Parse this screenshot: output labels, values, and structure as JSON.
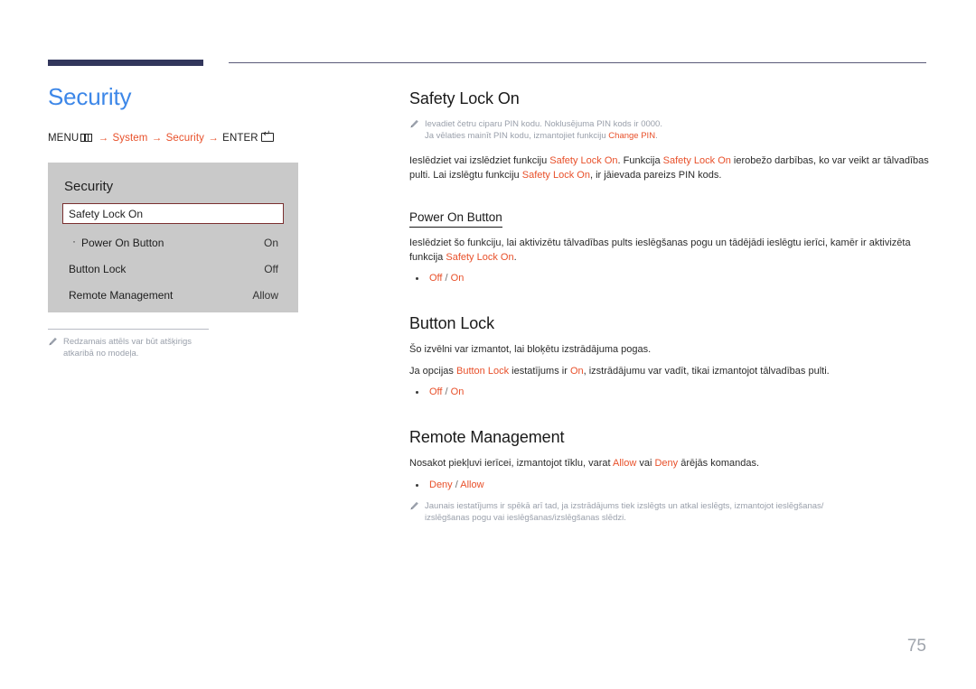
{
  "header": {
    "rule_color_thick": "#32365c",
    "rule_color_thin": "#5a5a78"
  },
  "left": {
    "page_title": "Security",
    "breadcrumb": {
      "menu_label": "MENU",
      "menu_icon": "menu-grid-icon",
      "arrow": "→",
      "item1": "System",
      "item2": "Security",
      "enter_label": "ENTER",
      "enter_icon": "enter-key-icon"
    },
    "osd": {
      "title": "Security",
      "rows": [
        {
          "label": "Safety Lock On",
          "value": "",
          "selected": true,
          "sub": false
        },
        {
          "label": "Power On Button",
          "value": "On",
          "selected": false,
          "sub": true
        },
        {
          "label": "Button Lock",
          "value": "Off",
          "selected": false,
          "sub": false
        },
        {
          "label": "Remote Management",
          "value": "Allow",
          "selected": false,
          "sub": false
        }
      ]
    },
    "note": "Redzamais attēls var būt atšķirigs atkaribā no modeļa."
  },
  "right": {
    "sections": [
      {
        "heading": "Safety Lock On",
        "note_line1": "Ievadiet četru ciparu PIN kodu. Noklusējuma PIN kods ir 0000.",
        "note_line2_a": "Ja vēlaties mainīt PIN kodu, izmantojiet funkciju ",
        "note_line2_b": "Change PIN",
        "note_line2_c": ".",
        "body_a": "Ieslēdziet vai izslēdziet funkciju ",
        "body_b": "Safety Lock On",
        "body_c": ". Funkcija ",
        "body_d": "Safety Lock On",
        "body_e": " ierobežo darbības, ko var veikt ar tālvadības pulti. Lai izslēgtu funkciju ",
        "body_f": "Safety Lock On",
        "body_g": ", ir jāievada pareizs PIN kods."
      }
    ],
    "power_on_button": {
      "heading": "Power On Button",
      "body_a": "Ieslēdziet šo funkciju, lai aktivizētu tālvadības pults ieslēgšanas pogu un tādējādi ieslēgtu ierīci, kamēr ir aktivizēta funkcija ",
      "body_b": "Safety Lock On",
      "body_c": ".",
      "option_off": "Off",
      "option_slash": " / ",
      "option_on": "On"
    },
    "button_lock": {
      "heading": "Button Lock",
      "body1": "Šo izvēlni var izmantot, lai bloķētu izstrādājuma pogas.",
      "body2_a": "Ja opcijas ",
      "body2_b": "Button Lock",
      "body2_c": " iestatījums ir ",
      "body2_d": "On",
      "body2_e": ", izstrādājumu var vadīt, tikai izmantojot tālvadības pulti.",
      "option_off": "Off",
      "option_slash": " / ",
      "option_on": "On"
    },
    "remote_management": {
      "heading": "Remote Management",
      "body_a": "Nosakot piekļuvi ierīcei, izmantojot tīklu, varat ",
      "body_b": "Allow",
      "body_c": " vai ",
      "body_d": "Deny",
      "body_e": " ārējās komandas.",
      "option_deny": "Deny",
      "option_slash": " / ",
      "option_allow": "Allow",
      "note_line1": "Jaunais iestatījums ir spēkā arī tad, ja izstrādājums tiek izslēgts un atkal ieslēgts, izmantojot ieslēgšanas/",
      "note_line2": "izslēgšanas pogu vai ieslēgšanas/izslēgšanas slēdzi."
    }
  },
  "footer": {
    "page_number": "75"
  },
  "colors": {
    "accent_orange": "#e8502a",
    "title_blue": "#3d87e8",
    "osd_bg": "#c9c9c9",
    "note_grey": "#9aa0ab"
  }
}
